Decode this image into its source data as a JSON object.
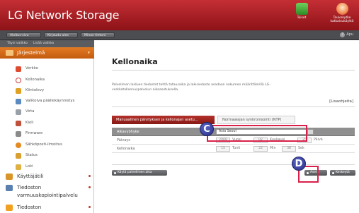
{
  "header": {
    "title": "LG Network Storage",
    "buttons": [
      {
        "label": "Toiset",
        "icon": "apps-icon"
      },
      {
        "label": "Taukokytke\nkatkaisukäyttö",
        "icon": "power-icon"
      }
    ]
  },
  "nav": {
    "buttons": [
      "Aloitus-sivu",
      "Kirjaudu ulos",
      "Minun tietoni"
    ],
    "help": "Apu"
  },
  "sidebar": {
    "top": [
      "Täysi valikko",
      "Lisää valikko"
    ],
    "section": "Järjestelmä",
    "items": [
      {
        "label": "Verkko",
        "icon": "network-icon",
        "color": "#e04a2f"
      },
      {
        "label": "Kellonaika",
        "icon": "clock-icon",
        "color": "#d23a3a"
      },
      {
        "label": "Kiintolevy",
        "icon": "disk-icon",
        "color": "#e0a020"
      },
      {
        "label": "Valikoiva päällekäynnistys",
        "icon": "power-schedule-icon",
        "color": "#5a8ac0"
      },
      {
        "label": "Virta",
        "icon": "power-icon",
        "color": "#9aa0a8"
      },
      {
        "label": "Kieli",
        "icon": "language-icon",
        "color": "#c0503a"
      },
      {
        "label": "Firmware",
        "icon": "firmware-icon",
        "color": "#8a8a8a"
      },
      {
        "label": "Sähköposti-ilmoitus",
        "icon": "mail-icon",
        "color": "#e48a20"
      },
      {
        "label": "Status",
        "icon": "status-icon",
        "color": "#d9a030"
      },
      {
        "label": "Loki",
        "icon": "log-icon",
        "color": "#e0b040"
      }
    ],
    "groups": [
      {
        "label": "Käyttäjätili",
        "icon": "user-icon",
        "color": "#d9952a"
      },
      {
        "label": "Tiedoston",
        "icon": "file-backup-icon",
        "color": "#5a80b0"
      },
      {
        "label": "varmuuskopiointipalvelu",
        "icon": "",
        "color": ""
      },
      {
        "label": "Tiedoston",
        "icon": "file-share-icon",
        "color": "#f2a020"
      }
    ]
  },
  "main": {
    "title": "Kellonaika",
    "description": "Palvelimen laiduen tiedostot tehtä tatausaika ja lakisiedosto asadaan nakumen määrittämillä LG-verkkotallennuspalvelun aikaasetuksella.",
    "more_link": "[Lisaohjeita]",
    "tabs": {
      "active": "Manuaalinen päivityksen ja kellonajan asetu...",
      "inactive": "Normaalajan synkronisointi (NTP)"
    },
    "rows": {
      "timezone_label": "Aikavyöhyke",
      "timezone_value": "Asia Seoul",
      "date_label": "Päivays",
      "date_year": "2009",
      "date_year_unit": "Vuosi",
      "date_month": "02",
      "date_month_unit": "Kuukausi",
      "date_day": "25",
      "date_day_unit": "Päivä",
      "time_label": "Kellonaika",
      "time_hour": "15",
      "time_hour_unit": "Tunti",
      "time_min": "22",
      "time_min_unit": "Min",
      "time_sec": "38",
      "time_sec_unit": "Sek"
    },
    "buttons": {
      "use_pc_time": "Käytä palvelimen aika",
      "apply": "Asetu",
      "cancel": "Keskeytä"
    },
    "annotations": [
      "C",
      "D"
    ]
  },
  "colors": {
    "brand_red": "#a01c22",
    "section_orange": "#d9681a",
    "annotation": "#d9204a",
    "badge": "#2f348a"
  }
}
